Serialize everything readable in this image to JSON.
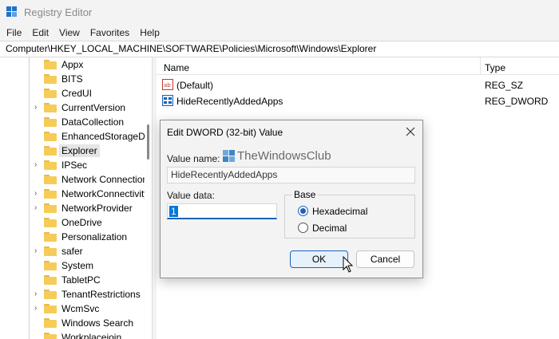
{
  "window": {
    "title": "Registry Editor"
  },
  "menu": [
    "File",
    "Edit",
    "View",
    "Favorites",
    "Help"
  ],
  "address": "Computer\\HKEY_LOCAL_MACHINE\\SOFTWARE\\Policies\\Microsoft\\Windows\\Explorer",
  "tree": {
    "items": [
      {
        "label": "Appx",
        "expandable": false
      },
      {
        "label": "BITS",
        "expandable": false
      },
      {
        "label": "CredUI",
        "expandable": false
      },
      {
        "label": "CurrentVersion",
        "expandable": true
      },
      {
        "label": "DataCollection",
        "expandable": false
      },
      {
        "label": "EnhancedStorageDevices",
        "expandable": false
      },
      {
        "label": "Explorer",
        "expandable": false,
        "selected": true
      },
      {
        "label": "IPSec",
        "expandable": true
      },
      {
        "label": "Network Connections",
        "expandable": false
      },
      {
        "label": "NetworkConnectivityStatusIndicator",
        "expandable": true
      },
      {
        "label": "NetworkProvider",
        "expandable": true
      },
      {
        "label": "OneDrive",
        "expandable": false
      },
      {
        "label": "Personalization",
        "expandable": false
      },
      {
        "label": "safer",
        "expandable": true
      },
      {
        "label": "System",
        "expandable": false
      },
      {
        "label": "TabletPC",
        "expandable": false
      },
      {
        "label": "TenantRestrictions",
        "expandable": true
      },
      {
        "label": "WcmSvc",
        "expandable": true
      },
      {
        "label": "Windows Search",
        "expandable": false
      },
      {
        "label": "Workplacejoin",
        "expandable": false
      }
    ]
  },
  "values": {
    "headers": {
      "name": "Name",
      "type": "Type"
    },
    "rows": [
      {
        "name": "(Default)",
        "type": "REG_SZ",
        "icon": "string-value-icon"
      },
      {
        "name": "HideRecentlyAddedApps",
        "type": "REG_DWORD",
        "icon": "dword-value-icon"
      }
    ]
  },
  "dialog": {
    "title": "Edit DWORD (32-bit) Value",
    "value_name_label": "Value name:",
    "value_name": "HideRecentlyAddedApps",
    "value_data_label": "Value data:",
    "value_data": "1",
    "base_label": "Base",
    "base_options": [
      {
        "label": "Hexadecimal",
        "checked": true
      },
      {
        "label": "Decimal",
        "checked": false
      }
    ],
    "ok_label": "OK",
    "cancel_label": "Cancel",
    "watermark": "TheWindowsClub"
  },
  "colors": {
    "accent": "#1b63b8",
    "folder": "#f6cc59",
    "selection": "#0078d7"
  }
}
